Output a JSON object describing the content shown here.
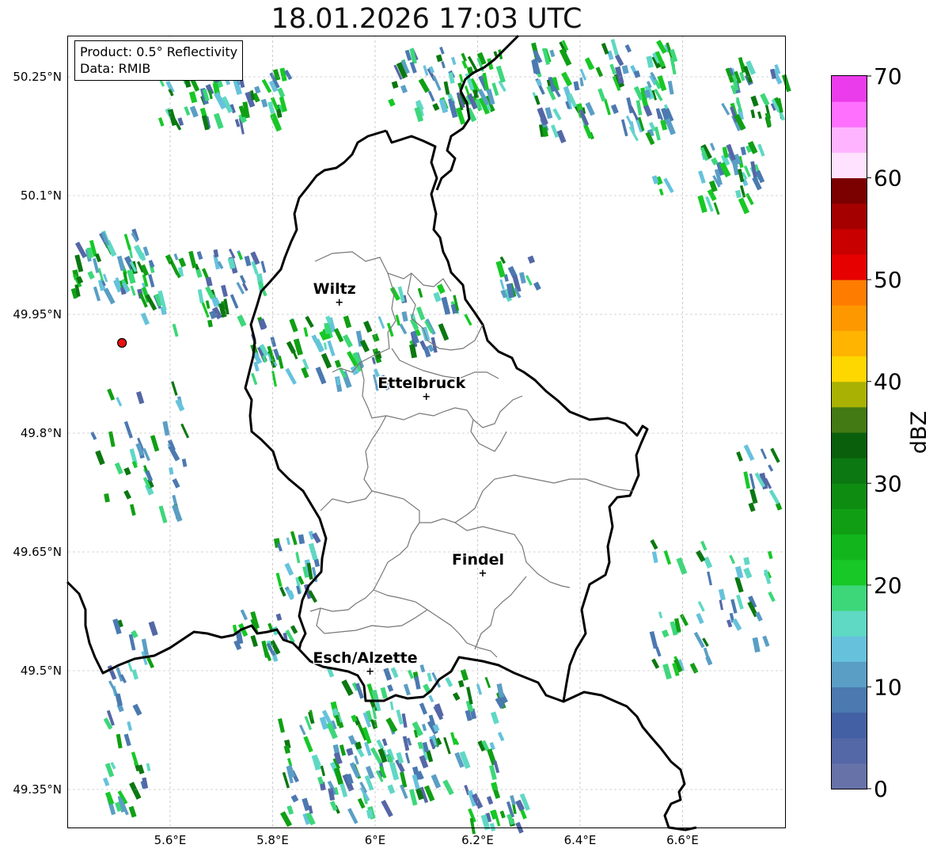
{
  "title": "18.01.2026 17:03 UTC",
  "info_box": {
    "product": "Product: 0.5° Reflectivity",
    "data": "Data: RMIB"
  },
  "map": {
    "lon_range": [
      5.4,
      6.8
    ],
    "lat_range": [
      49.3,
      50.3
    ],
    "lon_ticks": [
      {
        "value": 5.6,
        "label": "5.6°E"
      },
      {
        "value": 5.8,
        "label": "5.8°E"
      },
      {
        "value": 6.0,
        "label": "6°E"
      },
      {
        "value": 6.2,
        "label": "6.2°E"
      },
      {
        "value": 6.4,
        "label": "6.4°E"
      },
      {
        "value": 6.6,
        "label": "6.6°E"
      }
    ],
    "lat_ticks": [
      {
        "value": 50.25,
        "label": "50.25°N"
      },
      {
        "value": 50.1,
        "label": "50.1°N"
      },
      {
        "value": 49.95,
        "label": "49.95°N"
      },
      {
        "value": 49.8,
        "label": "49.8°N"
      },
      {
        "value": 49.65,
        "label": "49.65°N"
      },
      {
        "value": 49.5,
        "label": "49.5°N"
      },
      {
        "value": 49.35,
        "label": "49.35°N"
      }
    ],
    "grid": true,
    "cities": [
      {
        "name": "Wiltz",
        "lon": 5.93,
        "lat": 49.966
      },
      {
        "name": "Ettelbruck",
        "lon": 6.1,
        "lat": 49.847
      },
      {
        "name": "Findel",
        "lon": 6.21,
        "lat": 49.624
      },
      {
        "name": "Esch/Alzette",
        "lon": 5.99,
        "lat": 49.5
      }
    ],
    "radar_site": {
      "lon": 5.506,
      "lat": 49.914
    }
  },
  "colorbar": {
    "label": "dBZ",
    "min": 0,
    "max": 70,
    "step": 2.5,
    "ticks": [
      {
        "value": 0,
        "label": "0"
      },
      {
        "value": 10,
        "label": "10"
      },
      {
        "value": 20,
        "label": "20"
      },
      {
        "value": 30,
        "label": "30"
      },
      {
        "value": 40,
        "label": "40"
      },
      {
        "value": 50,
        "label": "50"
      },
      {
        "value": 60,
        "label": "60"
      },
      {
        "value": 70,
        "label": "70"
      }
    ],
    "colors": [
      "#6672a8",
      "#5467a6",
      "#4360a4",
      "#4b79b0",
      "#5a9ec5",
      "#66c2dc",
      "#5fd8c4",
      "#3dd77a",
      "#17c826",
      "#12b61c",
      "#109f14",
      "#0e8c12",
      "#0b7811",
      "#0a5f0d",
      "#437a13",
      "#a9b202",
      "#fed700",
      "#feb400",
      "#fe9800",
      "#fe7d00",
      "#e60000",
      "#c80000",
      "#a40000",
      "#7b0000",
      "#ffe2ff",
      "#ffb4ff",
      "#ff70ff",
      "#eb3ceb"
    ]
  }
}
